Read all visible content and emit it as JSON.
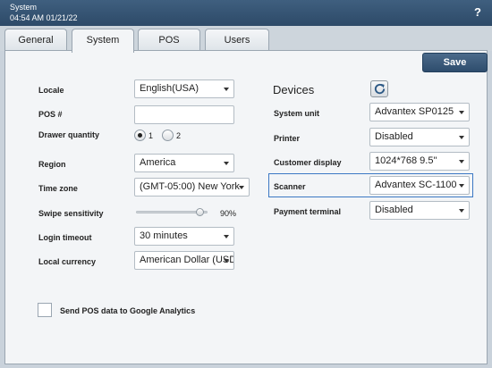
{
  "titlebar": {
    "app": "System",
    "datetime": "04:54 AM 01/21/22",
    "help": "?"
  },
  "tabs": [
    "General",
    "System",
    "POS",
    "Users"
  ],
  "save_label": "Save",
  "left": {
    "locale_label": "Locale",
    "locale_value": "English(USA)",
    "pos_label": "POS #",
    "pos_value": "",
    "drawer_label": "Drawer quantity",
    "drawer_opt1": "1",
    "drawer_opt2": "2",
    "drawer_selected": "1",
    "region_label": "Region",
    "region_value": "America",
    "timezone_label": "Time zone",
    "timezone_value": "(GMT-05:00) New York",
    "swipe_label": "Swipe sensitivity",
    "swipe_value": "90%",
    "swipe_level": 0.9,
    "login_label": "Login timeout",
    "login_value": "30 minutes",
    "currency_label": "Local currency",
    "currency_value": "American Dollar (USD)",
    "analytics_label": "Send POS data to Google Analytics",
    "analytics_checked": false
  },
  "devices": {
    "heading": "Devices",
    "system_unit_label": "System unit",
    "system_unit_value": "Advantex SP0125",
    "printer_label": "Printer",
    "printer_value": "Disabled",
    "display_label": "Customer display",
    "display_value": "1024*768 9.5\"",
    "scanner_label": "Scanner",
    "scanner_value": "Advantex SC-1100",
    "payment_label": "Payment terminal",
    "payment_value": "Disabled"
  },
  "icons": {
    "help": "help-icon",
    "refresh": "refresh-icon",
    "dropdown": "chevron-down-icon"
  }
}
